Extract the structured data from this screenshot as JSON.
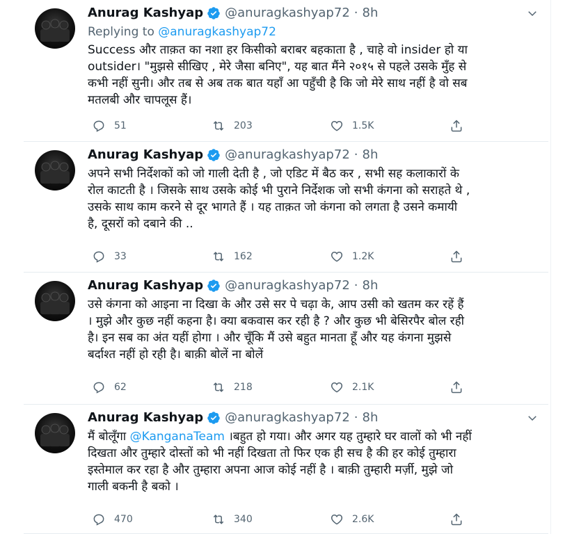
{
  "tweets": [
    {
      "name": "Anurag Kashyap",
      "handle": "@anuragkashyap72",
      "time": "8h",
      "replying_prefix": "Replying to",
      "replying_to": "@anuragkashyap72",
      "lines": [
        "Success और ताक़त का नशा हर किसीको बराबर बहकाता है , चाहे वो insider हो या",
        "outsider। \"मुझसे सीखिए , मेरे जैसा बनिए\", यह बात मैंने २०१५ से पहले उसके मुँह से",
        "कभी नहीं सुनी। और तब से अब तक बात यहाँ आ पहुँची है कि जो मेरे साथ नहीं है वो सब",
        "मतलबी और चापलूस हैं।"
      ],
      "replies": "51",
      "retweets": "203",
      "likes": "1.5K"
    },
    {
      "name": "Anurag Kashyap",
      "handle": "@anuragkashyap72",
      "time": "8h",
      "lines": [
        "अपने सभी निर्देशकों को जो गाली देती है , जो एडिट में बैठ कर , सभी सह कलाकारों के",
        "रोल काटती है । जिसके साथ उसके कोई भी पुराने निर्देशक जो सभी कंगना को सराहते थे ,",
        "उसके साथ काम करने से दूर भागते हैं । यह ताक़त जो कंगना को लगता है उसने कमायी",
        "है, दूसरों को दबाने की .."
      ],
      "replies": "33",
      "retweets": "162",
      "likes": "1.2K"
    },
    {
      "name": "Anurag Kashyap",
      "handle": "@anuragkashyap72",
      "time": "8h",
      "lines": [
        "उसे कंगना को आइना ना दिखा के और उसे सर पे चढ़ा के, आप उसी को खतम कर रहें हैं",
        "। मुझे और कुछ नहीं कहना है। क्या बकवास कर रही है ? और कुछ भी बेसिरपैर बोल रही",
        "है। इन सब का अंत यहीं होगा । और चूँकि मैं उसे बहुत मानता हूँ और यह कंगना मुझसे",
        "बर्दाश्त नहीं हो रही है। बाक़ी बोलें ना बोलें"
      ],
      "replies": "62",
      "retweets": "218",
      "likes": "2.1K"
    },
    {
      "name": "Anurag Kashyap",
      "handle": "@anuragkashyap72",
      "time": "8h",
      "line1_pre": "मैं बोलूँगा ",
      "line1_mention": "@KanganaTeam",
      "line1_post": " ।बहुत हो गया। और अगर यह तुम्हारे घर वालों को भी नहीं",
      "lines": [
        "दिखता और तुम्हारे दोस्तों को भी नहीं दिखता तो फिर एक ही सच है की हर कोई तुम्हारा",
        "इस्तेमाल कर रहा है और तुम्हारा अपना आज कोई नहीं है । बाक़ी तुम्हारी मर्ज़ी, मुझे जो",
        "गाली बकनी है बको ।"
      ],
      "replies": "470",
      "retweets": "340",
      "likes": "2.6K"
    }
  ],
  "colors": {
    "accent": "#1d9bf0",
    "muted": "#536471",
    "text": "#0f1419",
    "divider": "#e6ecf0"
  },
  "icons": [
    "reply-icon",
    "retweet-icon",
    "like-icon",
    "share-icon",
    "verified-badge-icon",
    "chevron-down-icon"
  ]
}
